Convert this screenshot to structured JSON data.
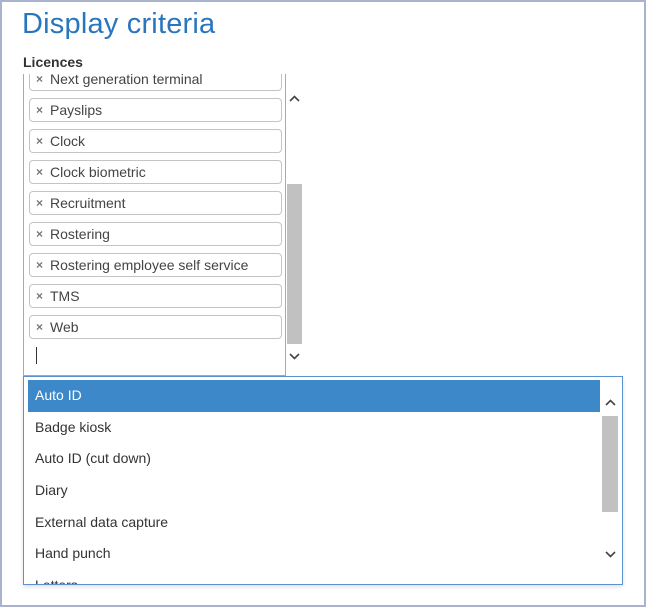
{
  "page": {
    "title": "Display criteria"
  },
  "licences": {
    "label": "Licences",
    "selected": [
      "Next generation terminal",
      "Payslips",
      "Clock",
      "Clock biometric",
      "Recruitment",
      "Rostering",
      "Rostering employee self service",
      "TMS",
      "Web"
    ],
    "remove_glyph": "×",
    "search_value": ""
  },
  "dropdown": {
    "options": [
      "Auto ID",
      "Badge kiosk",
      "Auto ID (cut down)",
      "Diary",
      "External data capture",
      "Hand punch",
      "Letters"
    ],
    "highlighted": "Auto ID"
  },
  "colors": {
    "title": "#2a76be",
    "highlight": "#3c88c8",
    "border": "#a8b4cc"
  },
  "icons": {
    "scroll_up": "chevron-up-icon",
    "scroll_down": "chevron-down-icon",
    "remove": "remove-x-icon"
  }
}
